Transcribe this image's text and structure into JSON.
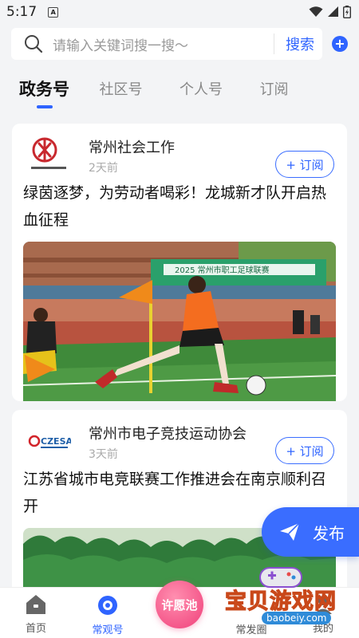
{
  "status_bar": {
    "time": "5:17",
    "badge": "A"
  },
  "search": {
    "placeholder": "请输入关键词搜一搜～",
    "button_label": "搜索"
  },
  "tabs": [
    {
      "label": "政务号",
      "active": true
    },
    {
      "label": "社区号",
      "active": false
    },
    {
      "label": "个人号",
      "active": false
    },
    {
      "label": "订阅",
      "active": false
    }
  ],
  "posts": [
    {
      "account": "常州社会工作",
      "time": "2天前",
      "subscribe_label": "+ 订阅",
      "title": "绿茵逐梦，为劳动者喝彩！龙城新才队开启热血征程",
      "image_banner_text": "2025 常州市职工足球联赛"
    },
    {
      "account": "常州市电子竞技运动协会",
      "time": "3天前",
      "subscribe_label": "+ 订阅",
      "title": "江苏省城市电竞联赛工作推进会在南京顺利召开"
    }
  ],
  "fab": {
    "label": "发布"
  },
  "bottom_nav": [
    {
      "label": "首页",
      "icon": "home-icon",
      "active": false
    },
    {
      "label": "常观号",
      "icon": "changguan-icon",
      "active": true
    },
    {
      "label": "许愿池",
      "icon": "wish-icon",
      "active": false
    },
    {
      "label": "常发圈",
      "icon": "circle-icon",
      "active": false
    },
    {
      "label": "我的",
      "icon": "profile-icon",
      "active": false
    }
  ],
  "watermark": {
    "text": "宝贝游戏网",
    "url": "baobeiy.com"
  },
  "colors": {
    "accent": "#2f64ff",
    "wish": "#f0407a"
  }
}
